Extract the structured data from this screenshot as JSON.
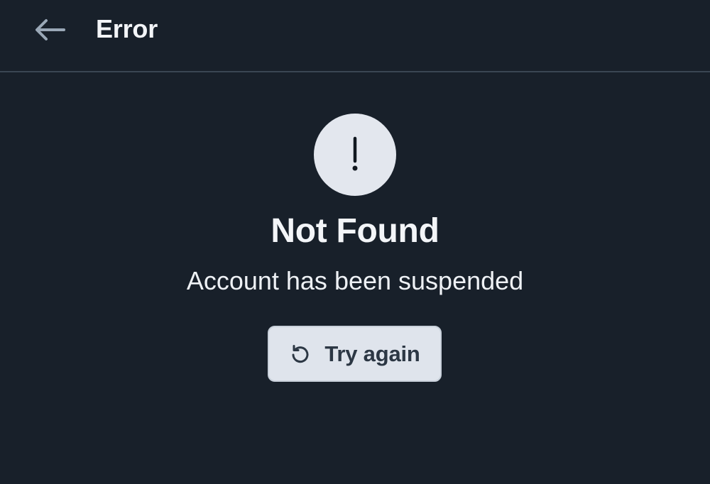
{
  "header": {
    "back_icon": "arrow-left-icon",
    "title": "Error"
  },
  "error": {
    "icon": "exclamation-icon",
    "title": "Not Found",
    "message": "Account has been suspended"
  },
  "actions": {
    "retry_icon": "refresh-icon",
    "retry_label": "Try again"
  },
  "colors": {
    "background": "#18202a",
    "divider": "#3a4653",
    "text": "#f3f5f8",
    "icon_circle": "#e3e7ee",
    "button_background": "#dfe4ec",
    "button_text": "#2c3744"
  }
}
